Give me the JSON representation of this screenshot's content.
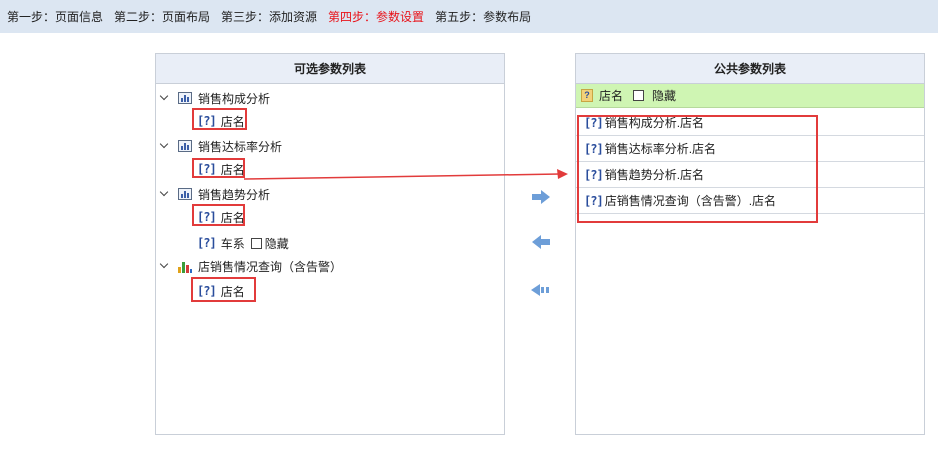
{
  "steps": [
    {
      "label": "第一步：页面信息"
    },
    {
      "label": "第二步：页面布局"
    },
    {
      "label": "第三步：添加资源"
    },
    {
      "label": "第四步：参数设置",
      "active": true
    },
    {
      "label": "第五步：参数布局"
    }
  ],
  "left_panel": {
    "title": "可选参数列表",
    "reports": [
      {
        "name": "销售构成分析",
        "icon": "report-icon",
        "params": [
          "店名"
        ]
      },
      {
        "name": "销售达标率分析",
        "icon": "report-icon",
        "params": [
          "店名"
        ]
      },
      {
        "name": "销售趋势分析",
        "icon": "report-icon",
        "params": [
          "店名",
          "车系"
        ],
        "hide_label": "隐藏"
      },
      {
        "name": "店销售情况查询（含告警）",
        "icon": "bar-chart-icon",
        "params": [
          "店名"
        ]
      }
    ]
  },
  "right_panel": {
    "title": "公共参数列表",
    "selected": {
      "name": "店名",
      "hide_label": "隐藏"
    },
    "items": [
      "销售构成分析.店名",
      "销售达标率分析.店名",
      "销售趋势分析.店名",
      "店销售情况查询（含告警）.店名"
    ]
  },
  "controls": {
    "add_icon": "arrow-right-icon",
    "remove_icon": "arrow-left-icon",
    "remove_all_icon": "double-arrow-left-icon"
  },
  "colors": {
    "highlight": "#e23b3b",
    "active_step": "#e8141b",
    "selected_row": "#cff5b3",
    "arrow": "#6d9ed8"
  },
  "question_glyph": "[?]"
}
